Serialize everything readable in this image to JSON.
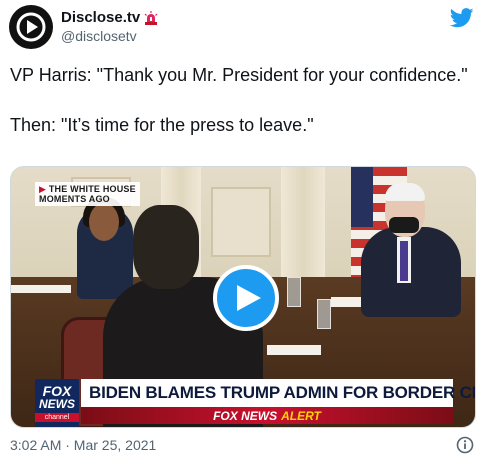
{
  "author": {
    "display_name": "Disclose.tv",
    "handle": "@disclosetv"
  },
  "tweet": {
    "text": "VP Harris: \"Thank you Mr. President for your confidence.\"\n\nThen: \"It’s time for the press to leave.\""
  },
  "media": {
    "overlay_label_line1": "THE WHITE HOUSE",
    "overlay_label_line2": "MOMENTS AGO",
    "logo_word": "FOX",
    "logo_news": "NEWS",
    "logo_channel": "channel",
    "headline": "BIDEN BLAMES TRUMP ADMIN FOR BORDER CRISIS",
    "alert_brand": "FOX NEWS",
    "alert_word": "ALERT"
  },
  "footer": {
    "timestamp": "3:02 AM · Mar 25, 2021"
  },
  "colors": {
    "twitter_blue": "#1d9bf0",
    "text_primary": "#0f1419",
    "text_secondary": "#536471",
    "fox_red": "#c8102e",
    "fox_navy": "#11285e"
  },
  "icons": [
    "disclose-logo-icon",
    "siren-icon",
    "twitter-bird-icon",
    "play-icon",
    "info-icon"
  ]
}
